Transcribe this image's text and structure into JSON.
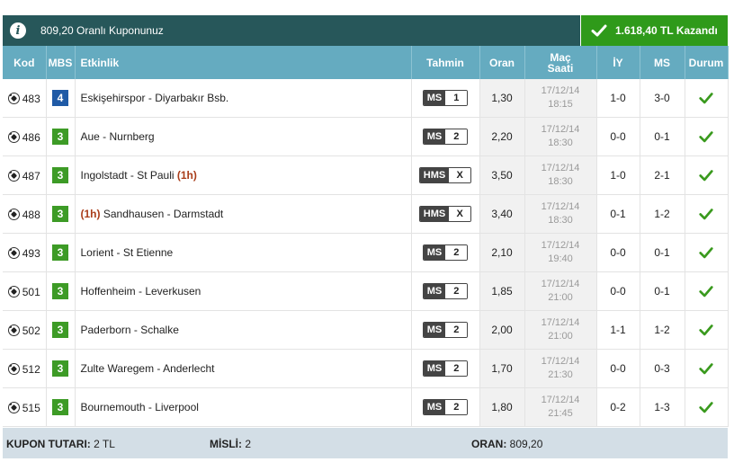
{
  "header": {
    "info_text": "809,20 Oranlı Kuponunuz",
    "won_text": "1.618,40 TL Kazandı"
  },
  "columns": {
    "kod": "Kod",
    "mbs": "MBS",
    "etkinlik": "Etkinlik",
    "tahmin": "Tahmin",
    "oran": "Oran",
    "mac_saati_1": "Maç",
    "mac_saati_2": "Saati",
    "iy": "İY",
    "ms": "MS",
    "durum": "Durum"
  },
  "rows": [
    {
      "code": "483",
      "mbs": "4",
      "mbs_color": "blue",
      "prefix": "",
      "event": "Eskişehirspor - Diyarbakır Bsb.",
      "suffix": "",
      "pick_type": "MS",
      "pick": "1",
      "odds": "1,30",
      "date": "17/12/14",
      "time": "18:15",
      "iy": "1-0",
      "ms": "3-0",
      "status": "won"
    },
    {
      "code": "486",
      "mbs": "3",
      "mbs_color": "green",
      "prefix": "",
      "event": "Aue - Nurnberg",
      "suffix": "",
      "pick_type": "MS",
      "pick": "2",
      "odds": "2,20",
      "date": "17/12/14",
      "time": "18:30",
      "iy": "0-0",
      "ms": "0-1",
      "status": "won"
    },
    {
      "code": "487",
      "mbs": "3",
      "mbs_color": "green",
      "prefix": "",
      "event": "Ingolstadt - St Pauli ",
      "suffix": "(1h)",
      "pick_type": "HMS",
      "pick": "X",
      "odds": "3,50",
      "date": "17/12/14",
      "time": "18:30",
      "iy": "1-0",
      "ms": "2-1",
      "status": "won"
    },
    {
      "code": "488",
      "mbs": "3",
      "mbs_color": "green",
      "prefix": "(1h) ",
      "event": "Sandhausen - Darmstadt",
      "suffix": "",
      "pick_type": "HMS",
      "pick": "X",
      "odds": "3,40",
      "date": "17/12/14",
      "time": "18:30",
      "iy": "0-1",
      "ms": "1-2",
      "status": "won"
    },
    {
      "code": "493",
      "mbs": "3",
      "mbs_color": "green",
      "prefix": "",
      "event": "Lorient - St Etienne",
      "suffix": "",
      "pick_type": "MS",
      "pick": "2",
      "odds": "2,10",
      "date": "17/12/14",
      "time": "19:40",
      "iy": "0-0",
      "ms": "0-1",
      "status": "won"
    },
    {
      "code": "501",
      "mbs": "3",
      "mbs_color": "green",
      "prefix": "",
      "event": "Hoffenheim - Leverkusen",
      "suffix": "",
      "pick_type": "MS",
      "pick": "2",
      "odds": "1,85",
      "date": "17/12/14",
      "time": "21:00",
      "iy": "0-0",
      "ms": "0-1",
      "status": "won"
    },
    {
      "code": "502",
      "mbs": "3",
      "mbs_color": "green",
      "prefix": "",
      "event": "Paderborn - Schalke",
      "suffix": "",
      "pick_type": "MS",
      "pick": "2",
      "odds": "2,00",
      "date": "17/12/14",
      "time": "21:00",
      "iy": "1-1",
      "ms": "1-2",
      "status": "won"
    },
    {
      "code": "512",
      "mbs": "3",
      "mbs_color": "green",
      "prefix": "",
      "event": "Zulte Waregem - Anderlecht",
      "suffix": "",
      "pick_type": "MS",
      "pick": "2",
      "odds": "1,70",
      "date": "17/12/14",
      "time": "21:30",
      "iy": "0-0",
      "ms": "0-3",
      "status": "won"
    },
    {
      "code": "515",
      "mbs": "3",
      "mbs_color": "green",
      "prefix": "",
      "event": "Bournemouth - Liverpool",
      "suffix": "",
      "pick_type": "MS",
      "pick": "2",
      "odds": "1,80",
      "date": "17/12/14",
      "time": "21:45",
      "iy": "0-2",
      "ms": "1-3",
      "status": "won"
    }
  ],
  "footer": {
    "stake_label": "KUPON TUTARI:",
    "stake_value": "2 TL",
    "multiple_label": "MİSLİ:",
    "multiple_value": "2",
    "odds_label": "ORAN:",
    "odds_value": "809,20"
  },
  "colors": {
    "topbar": "#27575a",
    "won": "#2f9a1a",
    "table_header": "#65abc0",
    "footer": "#d3dee6",
    "check": "#3a9a1e"
  }
}
